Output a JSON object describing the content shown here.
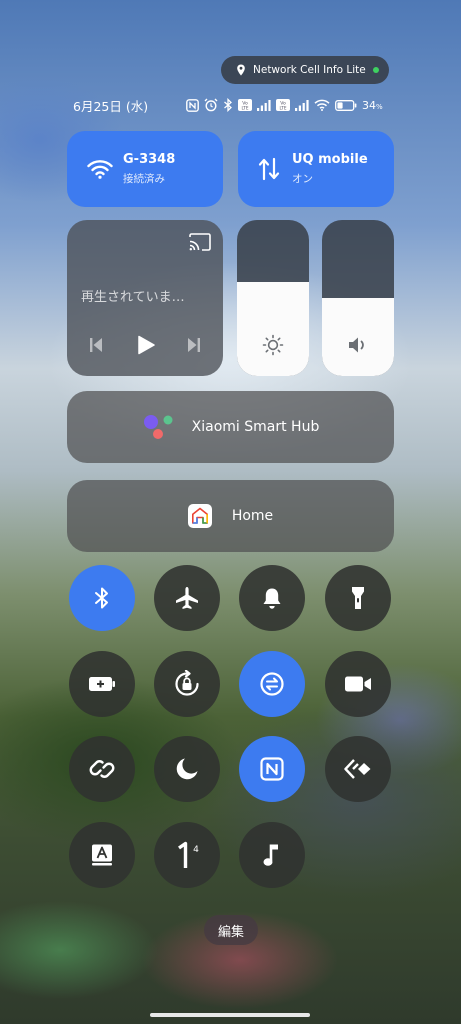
{
  "info_pill": {
    "label": "Network Cell Info Lite",
    "status_color": "#3ed160"
  },
  "status_bar": {
    "date": "6月25日 (水)",
    "icons": [
      "nfc-icon",
      "alarm-icon",
      "bluetooth-icon",
      "volte-icon",
      "signal-icon",
      "volte-icon",
      "signal-icon",
      "wifi-icon",
      "battery-icon"
    ],
    "battery": "34",
    "battery_unit": "%"
  },
  "wifi_tile": {
    "name": "G-3348",
    "status": "接続済み",
    "active": true
  },
  "mobile_tile": {
    "name": "UQ mobile",
    "status": "オン",
    "active": true
  },
  "media": {
    "text": "再生されていま…"
  },
  "sliders": {
    "brightness": 0.6,
    "volume": 0.5
  },
  "smart_hub": {
    "label": "Xiaomi Smart Hub"
  },
  "home": {
    "label": "Home"
  },
  "toggles": [
    {
      "name": "bluetooth",
      "active": true
    },
    {
      "name": "airplane",
      "active": false
    },
    {
      "name": "bell",
      "active": false
    },
    {
      "name": "flashlight",
      "active": false
    },
    {
      "name": "battery-saver",
      "active": false
    },
    {
      "name": "rotation-lock",
      "active": false
    },
    {
      "name": "data-saver",
      "active": true
    },
    {
      "name": "screen-record",
      "active": false
    },
    {
      "name": "link",
      "active": false
    },
    {
      "name": "dark-mode",
      "active": false
    },
    {
      "name": "nfc",
      "active": true
    },
    {
      "name": "nearby-share",
      "active": false
    },
    {
      "name": "font",
      "active": false
    },
    {
      "name": "one-handed",
      "active": false
    },
    {
      "name": "music",
      "active": false
    }
  ],
  "one_handed_superscript": "4",
  "edit_label": "編集",
  "colors": {
    "accent": "#3d7bf0",
    "inactive": "#303230"
  }
}
